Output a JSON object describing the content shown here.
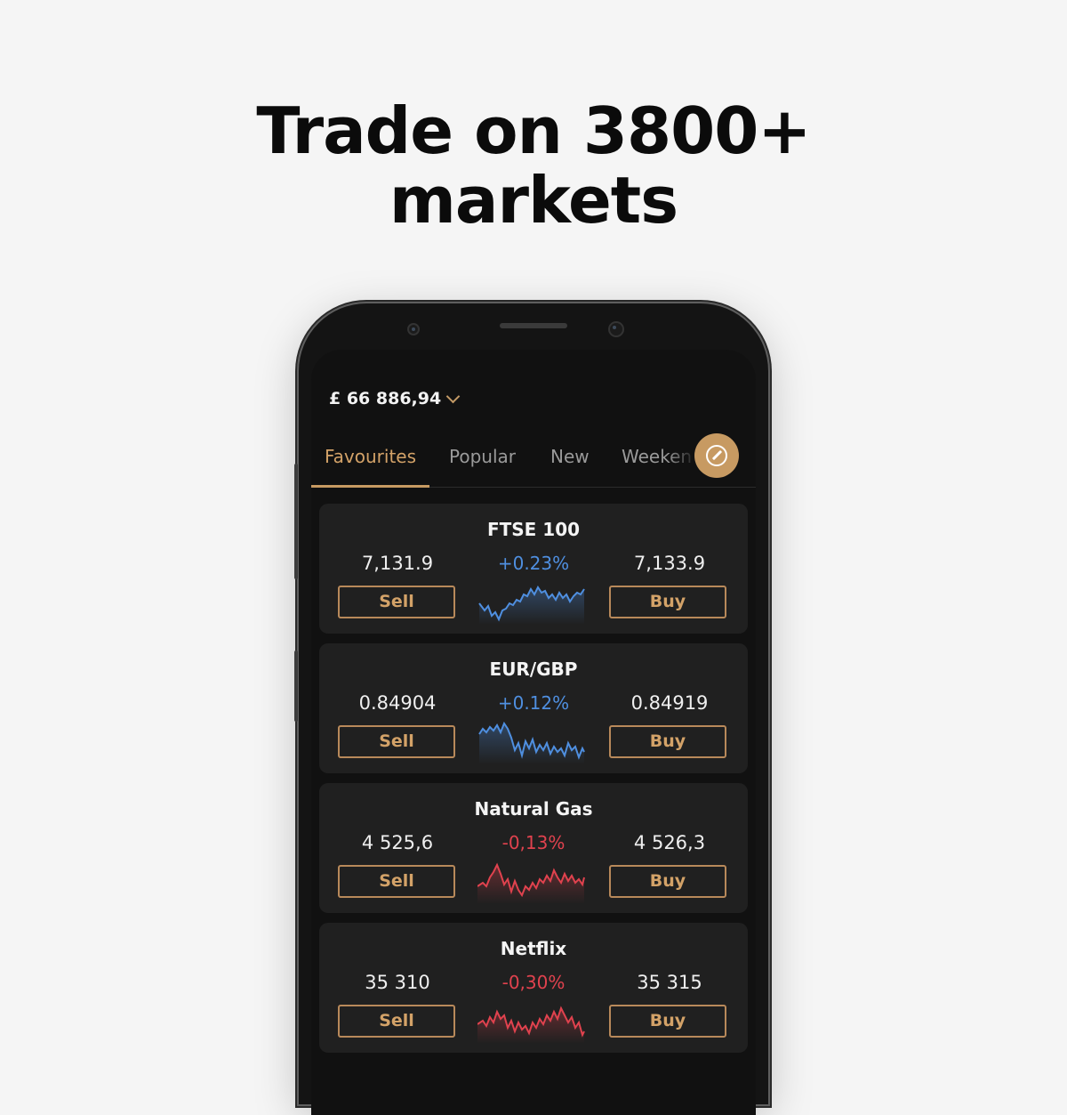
{
  "headline": {
    "line1": "Trade on 3800+",
    "line2": "markets"
  },
  "app": {
    "balance": "£ 66 886,94",
    "tabs": [
      {
        "label": "Favourites",
        "active": true
      },
      {
        "label": "Popular",
        "active": false
      },
      {
        "label": "New",
        "active": false
      },
      {
        "label": "Weeken",
        "active": false
      }
    ],
    "edit_icon": "pencil-icon",
    "colors": {
      "accent": "#c79a62",
      "up": "#4f8fe0",
      "down": "#e0424e",
      "background": "#111111",
      "card": "#202020"
    },
    "markets": [
      {
        "name": "FTSE 100",
        "sell_price": "7,131.9",
        "change": "+0.23%",
        "direction": "up",
        "buy_price": "7,133.9",
        "sell_label": "Sell",
        "buy_label": "Buy"
      },
      {
        "name": "EUR/GBP",
        "sell_price": "0.84904",
        "change": "+0.12%",
        "direction": "up",
        "buy_price": "0.84919",
        "sell_label": "Sell",
        "buy_label": "Buy"
      },
      {
        "name": "Natural Gas",
        "sell_price": "4 525,6",
        "change": "-0,13%",
        "direction": "down",
        "buy_price": "4 526,3",
        "sell_label": "Sell",
        "buy_label": "Buy"
      },
      {
        "name": "Netflix",
        "sell_price": "35 310",
        "change": "-0,30%",
        "direction": "down",
        "buy_price": "35 315",
        "sell_label": "Sell",
        "buy_label": "Buy"
      }
    ]
  }
}
